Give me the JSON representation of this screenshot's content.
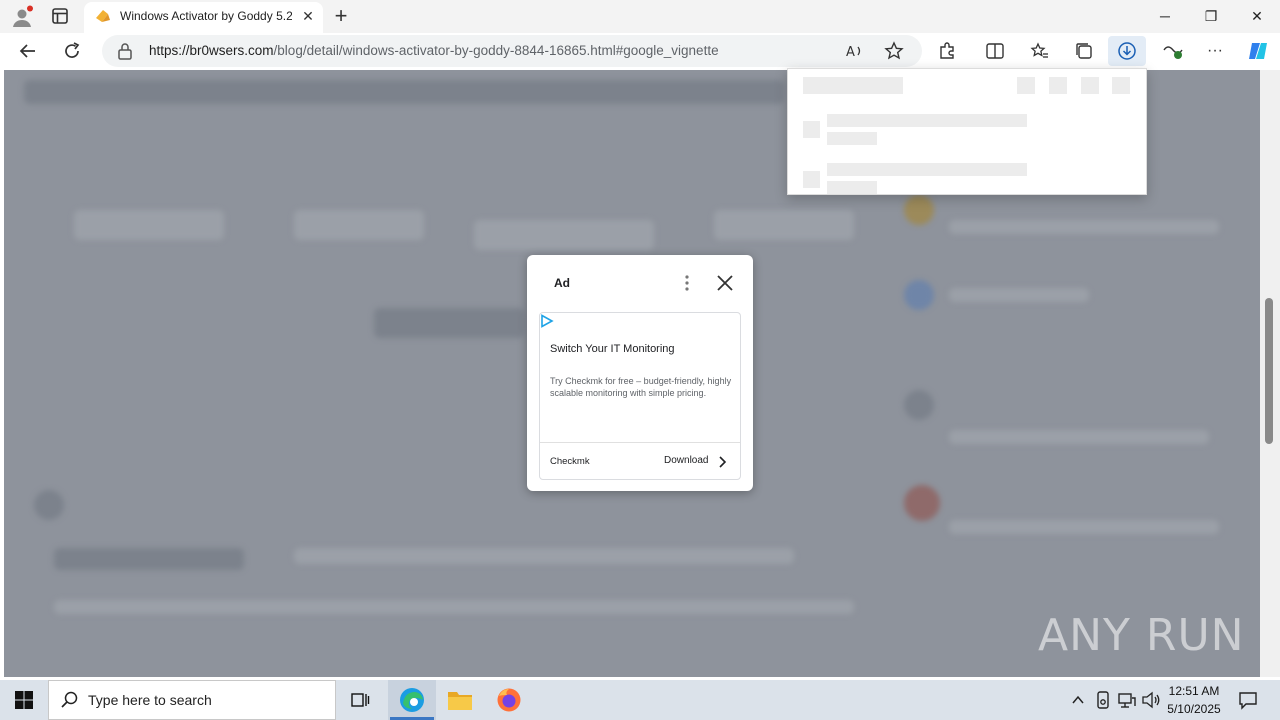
{
  "browser": {
    "tab_title": "Windows Activator by Goddy 5.2",
    "url_domain": "https://br0wsers.com",
    "url_path": "/blog/detail/windows-activator-by-goddy-8844-16865.html#google_vignette",
    "new_tab_label": "+",
    "window_controls": {
      "minimize": "─",
      "maximize": "❐",
      "close": "✕"
    }
  },
  "ad": {
    "label": "Ad",
    "headline": "Switch Your IT Monitoring",
    "body": "Try Checkmk for free – budget-friendly, highly scalable monitoring with simple pricing.",
    "advertiser": "Checkmk",
    "cta": "Download"
  },
  "taskbar": {
    "search_placeholder": "Type here to search",
    "time": "12:51 AM",
    "date": "5/10/2025"
  },
  "watermark": "ANY RUN",
  "colors": {
    "accent": "#3b77c3",
    "overlay": "#8e939c",
    "ad_icon": "#1fa3e6"
  }
}
